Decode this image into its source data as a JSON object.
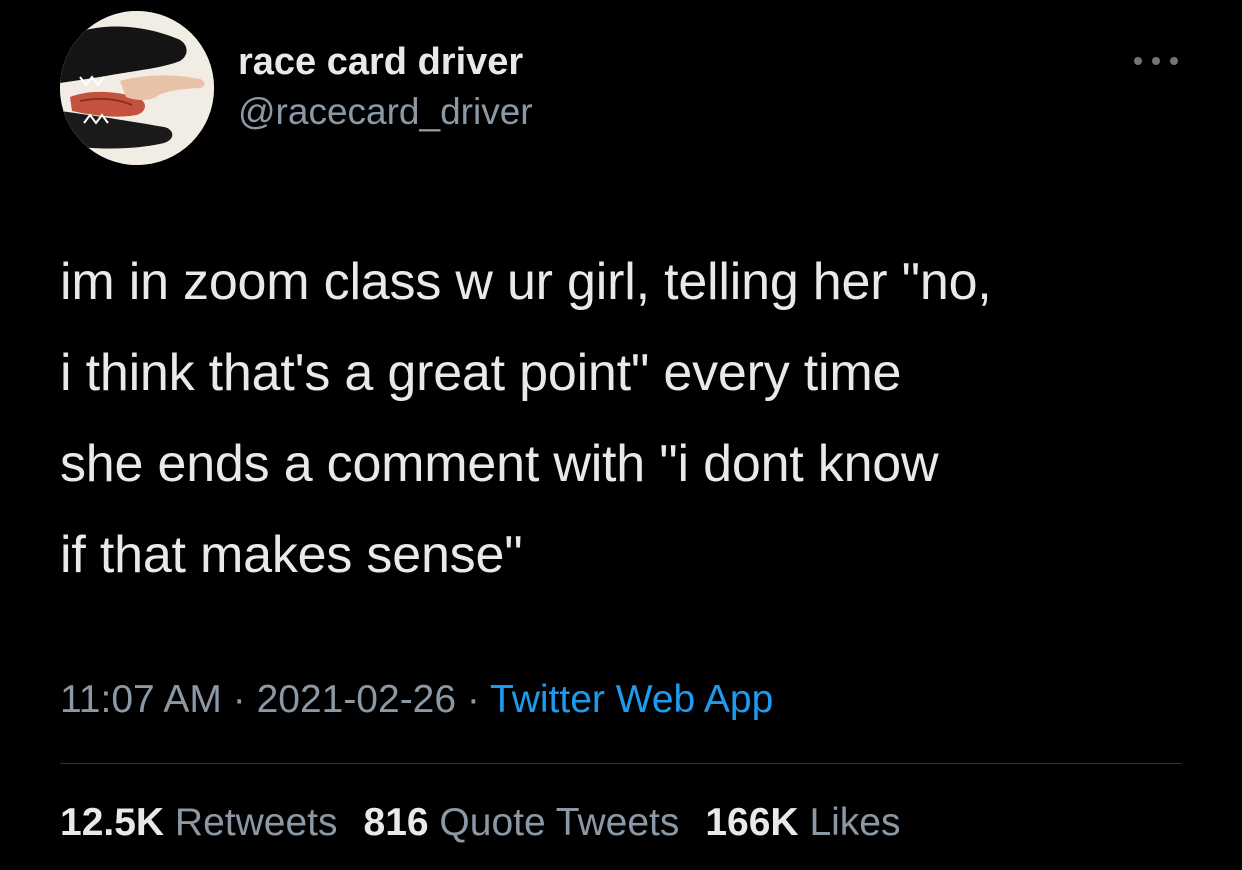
{
  "user": {
    "display_name": "race card driver",
    "handle": "@racecard_driver",
    "avatar_icon": "avatar-image"
  },
  "more_icon": "more-options-icon",
  "tweet": {
    "lines": [
      "im in zoom class w ur girl, telling her \"no,",
      "i think that's a great point\" every time",
      "she ends a comment with \"i dont know",
      "if that makes sense\""
    ]
  },
  "meta": {
    "time": "11:07 AM",
    "sep1": " · ",
    "date": "2021-02-26",
    "sep2": " · ",
    "source": "Twitter Web App"
  },
  "stats": {
    "retweets_count": "12.5K",
    "retweets_label": "Retweets",
    "quotes_count": "816",
    "quotes_label": "Quote Tweets",
    "likes_count": "166K",
    "likes_label": "Likes"
  },
  "colors": {
    "background": "#000000",
    "text": "#e7e9ea",
    "secondary": "#8b98a5",
    "link": "#1d9bf0",
    "divider": "#2f3336"
  }
}
